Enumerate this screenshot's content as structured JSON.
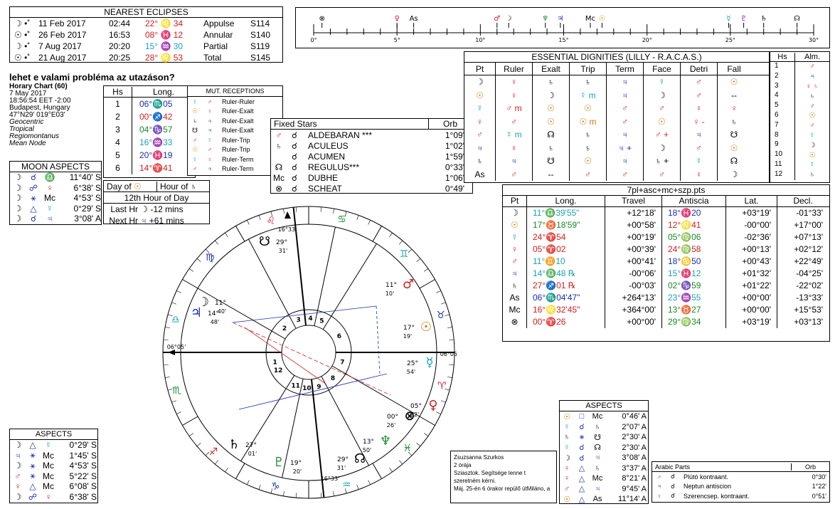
{
  "eclipses": {
    "title": "NEAREST ECLIPSES",
    "rows": [
      {
        "sym": "☽ •˚",
        "date": "11 Feb 2017",
        "time": "02:44",
        "pos": "22° ♌ 34",
        "type": "Appulse",
        "saros": "S114"
      },
      {
        "sym": "☉ •˚",
        "date": "26 Feb 2017",
        "time": "16:53",
        "pos": "08° ♓ 12",
        "type": "Annular",
        "saros": "S140"
      },
      {
        "sym": "☽ •˚",
        "date": "7 Aug 2017",
        "time": "20:20",
        "pos": "15° ♒ 30",
        "type": "Partial",
        "saros": "S119"
      },
      {
        "sym": "☉ •˚",
        "date": "21 Aug 2017",
        "time": "20:25",
        "pos": "28° ♌ 53",
        "type": "Total",
        "saros": "S145"
      }
    ]
  },
  "chart_info": {
    "question": "lehet e valami probléma az utazáson?",
    "lines": [
      "Horary Chart (60)",
      "7 May 2017",
      "18:56:54  EET -2:00",
      "Budapest, Hungary",
      "47°N29' 019°E03'",
      "Geocentric",
      "Tropical",
      "Regiomontanus",
      "Mean Node"
    ]
  },
  "houses": {
    "headers": [
      "Hs",
      "Long."
    ],
    "rows": [
      {
        "hs": "1",
        "long": "06°♏05"
      },
      {
        "hs": "2",
        "long": "00°♐42"
      },
      {
        "hs": "3",
        "long": "04°♑57"
      },
      {
        "hs": "4",
        "long": "16°♒33"
      },
      {
        "hs": "5",
        "long": "20°♓19"
      },
      {
        "hs": "6",
        "long": "14°♈41"
      }
    ]
  },
  "receptions": {
    "title": "MUT. RECEPTIONS",
    "rows": [
      {
        "a": "☿",
        "b": "♂",
        "t": "Ruler-Ruler"
      },
      {
        "a": "☉",
        "b": "♀",
        "t": "Ruler-Exalt"
      },
      {
        "a": "♄",
        "b": "♃",
        "t": "Ruler-Exalt"
      },
      {
        "a": "☋",
        "b": "♃",
        "t": "Ruler-Exalt"
      },
      {
        "a": "♂",
        "b": "☿",
        "t": "Ruler-Trip"
      },
      {
        "a": "☉",
        "b": "♂",
        "t": "Ruler-Trip"
      },
      {
        "a": "☿",
        "b": "♀",
        "t": "Ruler-Term"
      },
      {
        "a": "♂",
        "b": "♃",
        "t": "Ruler-Term"
      }
    ]
  },
  "moon_aspects": {
    "title": "MOON ASPECTS",
    "rows": [
      {
        "a": "☽",
        "asp": "☌",
        "b": "♎",
        "val": "11°40' S"
      },
      {
        "a": "☽",
        "asp": "☍",
        "b": "♀",
        "val": "6°38' S"
      },
      {
        "a": "☽",
        "asp": "⚹",
        "b": "Mc",
        "val": "4°53' S"
      },
      {
        "a": "☽",
        "asp": "△",
        "b": "☿",
        "val": "0°29' S"
      },
      {
        "a": "☽",
        "asp": "☌",
        "b": "♃",
        "val": "3°08' A"
      }
    ]
  },
  "hour": {
    "day_label": "Day of",
    "day_sym": "☉",
    "hour_label": "Hour of",
    "hour_sym": "♄",
    "title": "12th Hour of Day",
    "last_label": "Last Hr",
    "last_sym": "☽",
    "last_val": "-12 mins",
    "next_label": "Next Hr",
    "next_sym": "♃",
    "next_val": "+61 mins"
  },
  "fixed_stars": {
    "headers": [
      "Fixed Stars",
      "Orb"
    ],
    "rows": [
      {
        "p": "♂",
        "a": "☌",
        "name": "ALDEBARAN ***",
        "orb": "1°09'"
      },
      {
        "p": "♄",
        "a": "☌",
        "name": "ACULEUS",
        "orb": "1°02'"
      },
      {
        "p": "",
        "a": "☌",
        "name": "ACUMEN",
        "orb": "1°59'"
      },
      {
        "p": "☊",
        "a": "☌",
        "name": "REGULUS***",
        "orb": "0°33'"
      },
      {
        "p": "Mc",
        "a": "☌",
        "name": "DUBHE",
        "orb": "1°06'"
      },
      {
        "p": "⊗",
        "a": "☌",
        "name": "SCHEAT",
        "orb": "0°49'"
      }
    ]
  },
  "ruler_scale": {
    "labels": [
      "0°",
      "5°",
      "10°",
      "15°",
      "20°",
      "25°",
      "30°"
    ],
    "planets": [
      {
        "s": "⊗",
        "pos": 0.5,
        "c": "#000"
      },
      {
        "s": "♀",
        "pos": 5.0,
        "c": "#d02020"
      },
      {
        "s": "As",
        "pos": 6.0,
        "c": "#000"
      },
      {
        "s": "♂",
        "pos": 11.0,
        "c": "#d02020"
      },
      {
        "s": "☽",
        "pos": 11.7,
        "c": "#000"
      },
      {
        "s": "♆",
        "pos": 13.9,
        "c": "#178a2a"
      },
      {
        "s": "♃",
        "pos": 14.8,
        "c": "#1a2fb0"
      },
      {
        "s": "Mc",
        "pos": 16.6,
        "c": "#000"
      },
      {
        "s": "☉",
        "pos": 17.3,
        "c": "#cc7a00"
      },
      {
        "s": "☿",
        "pos": 24.9,
        "c": "#1aa3b8"
      },
      {
        "s": "♇",
        "pos": 25.8,
        "c": "#6a1fa0"
      },
      {
        "s": "♄",
        "pos": 27.0,
        "c": "#000"
      },
      {
        "s": "☊",
        "pos": 29.0,
        "c": "#000"
      }
    ]
  },
  "dignities": {
    "title": "ESSENTIAL DIGNITIES (LILLY - R.A.C.A.S.)",
    "headers": [
      "Pt",
      "Ruler",
      "Exalt",
      "Trip",
      "Term",
      "Face",
      "Detri",
      "Fall"
    ],
    "rows": [
      {
        "pt": "☽",
        "ruler": "♀",
        "exalt": "♄",
        "trip": "♄",
        "term": "♃",
        "face": "☿",
        "detri": "♂",
        "fall": "☉"
      },
      {
        "pt": "☉",
        "ruler": "♀",
        "exalt": "☽",
        "trip": "☿ m",
        "term": "♃",
        "face": "☽",
        "detri": "♂",
        "fall": "--"
      },
      {
        "pt": "☿",
        "ruler": "♂ m",
        "exalt": "☉",
        "trip": "☉",
        "term": "♂",
        "face": "♂",
        "detri": "♀",
        "fall": "♀"
      },
      {
        "pt": "♀",
        "ruler": "♂",
        "exalt": "☉",
        "trip": "☉ m",
        "term": "♂",
        "face": "☉",
        "detri": "♀ -",
        "fall": "♄"
      },
      {
        "pt": "♂",
        "ruler": "☿ m",
        "exalt": "☊",
        "trip": "♄",
        "term": "♃",
        "face": "♂ +",
        "detri": "♃",
        "fall": "☋"
      },
      {
        "pt": "♃",
        "ruler": "♀",
        "exalt": "♄",
        "trip": "♄",
        "term": "♃ +",
        "face": "☽",
        "detri": "♂",
        "fall": "☉"
      },
      {
        "pt": "♄",
        "ruler": "♃",
        "exalt": "☋",
        "trip": "☉",
        "term": "♃",
        "face": "♄ +",
        "detri": "☿",
        "fall": "☊"
      },
      {
        "pt": "As",
        "ruler": "♂",
        "exalt": "--",
        "trip": "♂",
        "term": "♂",
        "face": "♂",
        "detri": "♀",
        "fall": "☽"
      }
    ]
  },
  "almuten": {
    "headers": [
      "Hs",
      "Alm."
    ],
    "rows": [
      {
        "hs": "1",
        "alm": "♂"
      },
      {
        "hs": "2",
        "alm": "♃"
      },
      {
        "hs": "3",
        "alm": "♀ ♄"
      },
      {
        "hs": "4",
        "alm": "♄"
      },
      {
        "hs": "5",
        "alm": "♂"
      },
      {
        "hs": "6",
        "alm": "☉"
      },
      {
        "hs": "7",
        "alm": "♂"
      },
      {
        "hs": "8",
        "alm": "☿"
      },
      {
        "hs": "9",
        "alm": "☽"
      },
      {
        "hs": "10",
        "alm": "☉"
      },
      {
        "hs": "11",
        "alm": "☿"
      },
      {
        "hs": "12",
        "alm": "♄"
      }
    ]
  },
  "positions": {
    "title": "7pl+asc+mc+szp.pts",
    "headers": [
      "Pt",
      "Long.",
      "Travel",
      "Antiscia",
      "Lat.",
      "Decl."
    ],
    "rows": [
      {
        "pt": "☽",
        "long": "11°♎39'55\"",
        "travel": "+12°18'",
        "anti": "18°♓20",
        "lat": "+03°19'",
        "decl": "-01°33'"
      },
      {
        "pt": "☉",
        "long": "17°♉18'59\"",
        "travel": "+00°58'",
        "anti": "12°♌41",
        "lat": "-00°00'",
        "decl": "+17°00'"
      },
      {
        "pt": "☿",
        "long": "24°♈54",
        "travel": "+00°19'",
        "anti": "05°♍06",
        "lat": "-02°36'",
        "decl": "+07°13'"
      },
      {
        "pt": "♀",
        "long": "05°♈02",
        "travel": "+00°39'",
        "anti": "24°♍58",
        "lat": "+00°13'",
        "decl": "+02°12'"
      },
      {
        "pt": "♂",
        "long": "11°♊10",
        "travel": "+00°41'",
        "anti": "18°♋50",
        "lat": "+00°43'",
        "decl": "+22°49'"
      },
      {
        "pt": "♃",
        "long": "14°♎48 ℞",
        "travel": "-00°06'",
        "anti": "15°♓12",
        "lat": "+01°32'",
        "decl": "-04°25'"
      },
      {
        "pt": "♄",
        "long": "27°♐01 ℞",
        "travel": "-00°03'",
        "anti": "02°♑59",
        "lat": "+01°22'",
        "decl": "-22°02'"
      },
      {
        "pt": "As",
        "long": "06°♏04'47\"",
        "travel": "+264°13'",
        "anti": "23°♒55",
        "lat": "+00°00'",
        "decl": "-13°33'"
      },
      {
        "pt": "Mc",
        "long": "16°♌32'45\"",
        "travel": "+364°00'",
        "anti": "13°♉27",
        "lat": "+00°00'",
        "decl": "+15°53'"
      },
      {
        "pt": "⊗",
        "long": "00°♈26",
        "travel": "+00°00'",
        "anti": "29°♍34",
        "lat": "+03°19'",
        "decl": "+03°13'"
      }
    ]
  },
  "aspects_left": {
    "title": "ASPECTS",
    "rows": [
      {
        "a": "☽",
        "asp": "△",
        "b": "☿",
        "val": "0°29' S"
      },
      {
        "a": "♃",
        "asp": "⚹",
        "b": "Mc",
        "val": "1°45' S"
      },
      {
        "a": "☽",
        "asp": "⚹",
        "b": "Mc",
        "val": "4°53' S"
      },
      {
        "a": "♂",
        "asp": "⚹",
        "b": "Mc",
        "val": "5°22' S"
      },
      {
        "a": "♀",
        "asp": "△",
        "b": "Mc",
        "val": "6°08' S"
      },
      {
        "a": "☽",
        "asp": "☍",
        "b": "♀",
        "val": "6°38' S"
      }
    ]
  },
  "aspects_right": {
    "title": "ASPECTS",
    "rows": [
      {
        "a": "☉",
        "asp": "□",
        "b": "Mc",
        "val": "0°46' A"
      },
      {
        "a": "☿",
        "asp": "☌",
        "b": "♄",
        "val": "2°07' A"
      },
      {
        "a": "♄",
        "asp": "⚹",
        "b": "☋",
        "val": "2°30' A"
      },
      {
        "a": "☿",
        "asp": "☌",
        "b": "☊",
        "val": "2°30' A"
      },
      {
        "a": "☽",
        "asp": "☌",
        "b": "♃",
        "val": "3°08' A"
      },
      {
        "a": "♀",
        "asp": "△",
        "b": "♄",
        "val": "3°37' A"
      },
      {
        "a": "♀",
        "asp": "△",
        "b": "Mc",
        "val": "8°21' A"
      },
      {
        "a": "♂",
        "asp": "△",
        "b": "♃",
        "val": "9°45' A"
      },
      {
        "a": "☉",
        "asp": "△",
        "b": "As",
        "val": "11°14' A"
      }
    ]
  },
  "arabic_parts": {
    "headers": [
      "Arabic Parts",
      "Orb"
    ],
    "rows": [
      {
        "p": "♂",
        "a": "☌",
        "name": "Plútó kontraant.",
        "orb": "0°30'"
      },
      {
        "p": "♃",
        "a": "☌",
        "name": "Neptun antiscion",
        "orb": "1°22'"
      },
      {
        "p": "♀",
        "a": "☌",
        "name": "Szerencsep. kontraant.",
        "orb": "0°51'"
      }
    ]
  },
  "note": {
    "lines": [
      "Zsuzsanna Szurkos",
      "2 órája",
      "Sziasztok. Segítsége lenne t szeretném kérni.",
      "Máj. 25-én 6 órakor repülő útMiláno, a"
    ]
  },
  "wheel": {
    "house_numbers": [
      "1",
      "2",
      "3",
      "4",
      "5",
      "6",
      "7",
      "8",
      "9",
      "10",
      "11",
      "12"
    ],
    "signs": [
      "♌",
      "♋",
      "♊",
      "♉",
      "♈",
      "♓",
      "♒",
      "♑",
      "♐",
      "♏",
      "♎",
      "♍"
    ],
    "planets": [
      {
        "s": "☽",
        "deg": "11°",
        "min": "40'",
        "c": "#000"
      },
      {
        "s": "♃",
        "deg": "14°",
        "min": "48'",
        "c": "#1a2fb0"
      },
      {
        "s": "♂",
        "deg": "11°",
        "min": "10'",
        "c": "#d02020"
      },
      {
        "s": "☉",
        "deg": "17°",
        "min": "19'",
        "c": "#cc7a00"
      },
      {
        "s": "☿",
        "deg": "25°",
        "min": "54'",
        "c": "#1aa3b8"
      },
      {
        "s": "♀",
        "deg": "05°",
        "min": "02'",
        "c": "#d02020"
      },
      {
        "s": "⊗",
        "deg": "00°",
        "min": "26'",
        "c": "#000"
      },
      {
        "s": "☋",
        "deg": "29°",
        "min": "31'",
        "c": "#000"
      },
      {
        "s": "♆",
        "deg": "13°",
        "min": "50'",
        "c": "#178a2a"
      },
      {
        "s": "♇",
        "deg": "19°",
        "min": "20'",
        "c": "#178a2a"
      },
      {
        "s": "♄",
        "deg": "27°",
        "min": "01'",
        "c": "#000"
      },
      {
        "s": "☊",
        "deg": "29°",
        "min": "31'",
        "c": "#000"
      }
    ],
    "cusp_labels": [
      "16°33'",
      "16°33'",
      "06°05'",
      "06°05'"
    ]
  }
}
